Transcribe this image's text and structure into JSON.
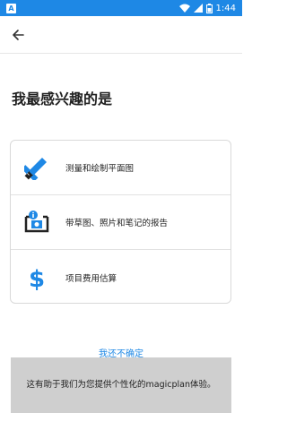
{
  "status_bar": {
    "notification_badge": "A",
    "time": "1:44",
    "icons": [
      "wifi-icon",
      "signal-icon",
      "battery-icon"
    ]
  },
  "app_bar": {
    "back_icon": "arrow-left-icon"
  },
  "title": "我最感兴趣的是",
  "options": [
    {
      "icon": "ruler-pencil-icon",
      "label": "测量和绘制平面图"
    },
    {
      "icon": "camera-info-icon",
      "label": "带草图、照片和笔记的报告"
    },
    {
      "icon": "dollar-icon",
      "label": "项目费用估算"
    }
  ],
  "not_sure_link": "我还不确定",
  "info_banner": "这有助于我们为您提供个性化的magicplan体验。",
  "colors": {
    "accent": "#1e88e5",
    "banner_bg": "#cfcfcf"
  }
}
